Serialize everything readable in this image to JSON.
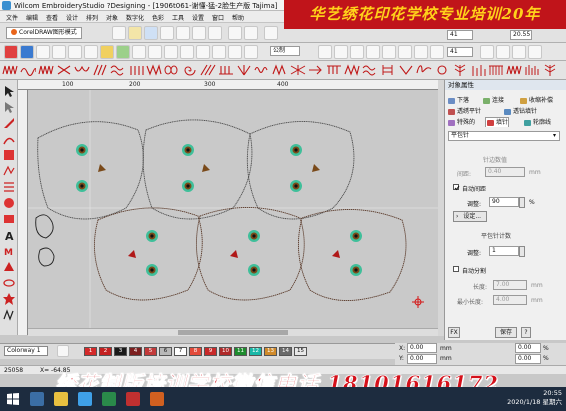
{
  "window": {
    "title": "Wilcom EmbroideryStudio ?Designing - [1906t061-谢懂-猛-2脸生产版        Tajima]"
  },
  "menu": [
    "文件",
    "编辑",
    "查看",
    "设计",
    "排列",
    "对象",
    "数字化",
    "色彩",
    "工具",
    "设置",
    "窗口",
    "帮助"
  ],
  "brand_banner": "华艺绣花印花学校专业培训20年",
  "toolbar": {
    "coreldraw_label": "CorelDRAW图形模式",
    "font_name": "公制",
    "stitch_count": "41",
    "stitch_count2": "41",
    "zoom": "20.55"
  },
  "ruler": {
    "labels": [
      "100",
      "200",
      "300",
      "400"
    ]
  },
  "panel": {
    "title": "对象属性",
    "tabs": [
      "下落",
      "连接",
      "收缩补偿",
      "透绣平针",
      "透钻填针",
      "特殊的",
      "填针",
      "轮廓线"
    ],
    "stitch_type": "平包针",
    "edge_section": "针边数值",
    "edge_label": "间距:",
    "edge_value": "0.40",
    "auto_spacing_label": "自动间距",
    "adjust_label": "调整:",
    "adjust_value": "90",
    "adjust_unit": "%",
    "settings_label": "设定...",
    "pitch_section": "平包针计数",
    "pitch_adjust_label": "调整:",
    "pitch_adjust_value": "1",
    "auto_split_label": "自动分割",
    "length_label": "长度:",
    "length_value": "7.00",
    "min_length_label": "最小长度:",
    "min_length_value": "4.00",
    "unit_mm": "mm",
    "fx_label": "FX",
    "save_label": "保存",
    "help_label": "?"
  },
  "colorbar": {
    "colorway": "Colorway 1",
    "swatches": [
      {
        "n": "1",
        "color": "#d42a2a"
      },
      {
        "n": "2",
        "color": "#c42020"
      },
      {
        "n": "3",
        "color": "#1a1a1a"
      },
      {
        "n": "4",
        "color": "#7c1f1f"
      },
      {
        "n": "5",
        "color": "#c23a3a"
      },
      {
        "n": "6",
        "color": "#b8b8b8"
      },
      {
        "n": "7",
        "color": "#ffffff"
      },
      {
        "n": "8",
        "color": "#e34a3a"
      },
      {
        "n": "9",
        "color": "#c82a2a"
      },
      {
        "n": "10",
        "color": "#b02a2a"
      },
      {
        "n": "11",
        "color": "#1e8c2e"
      },
      {
        "n": "12",
        "color": "#1ab8a8"
      },
      {
        "n": "13",
        "color": "#d08a2a"
      },
      {
        "n": "14",
        "color": "#6a6a6a"
      },
      {
        "n": "15",
        "color": "#e8e8e8"
      }
    ]
  },
  "coords": {
    "x_label": "X:",
    "y_label": "Y:",
    "x_value": "0.00",
    "y_value": "0.00",
    "unit": "mm",
    "pct": "0.00",
    "pct_unit": "%"
  },
  "status": {
    "left": "25058",
    "mid": "X= -64.85"
  },
  "phone_banner": "绣花制版培训学校微信电话 18101616172",
  "clock": {
    "time": "20:55",
    "date": "2020/1/18 星期六"
  }
}
